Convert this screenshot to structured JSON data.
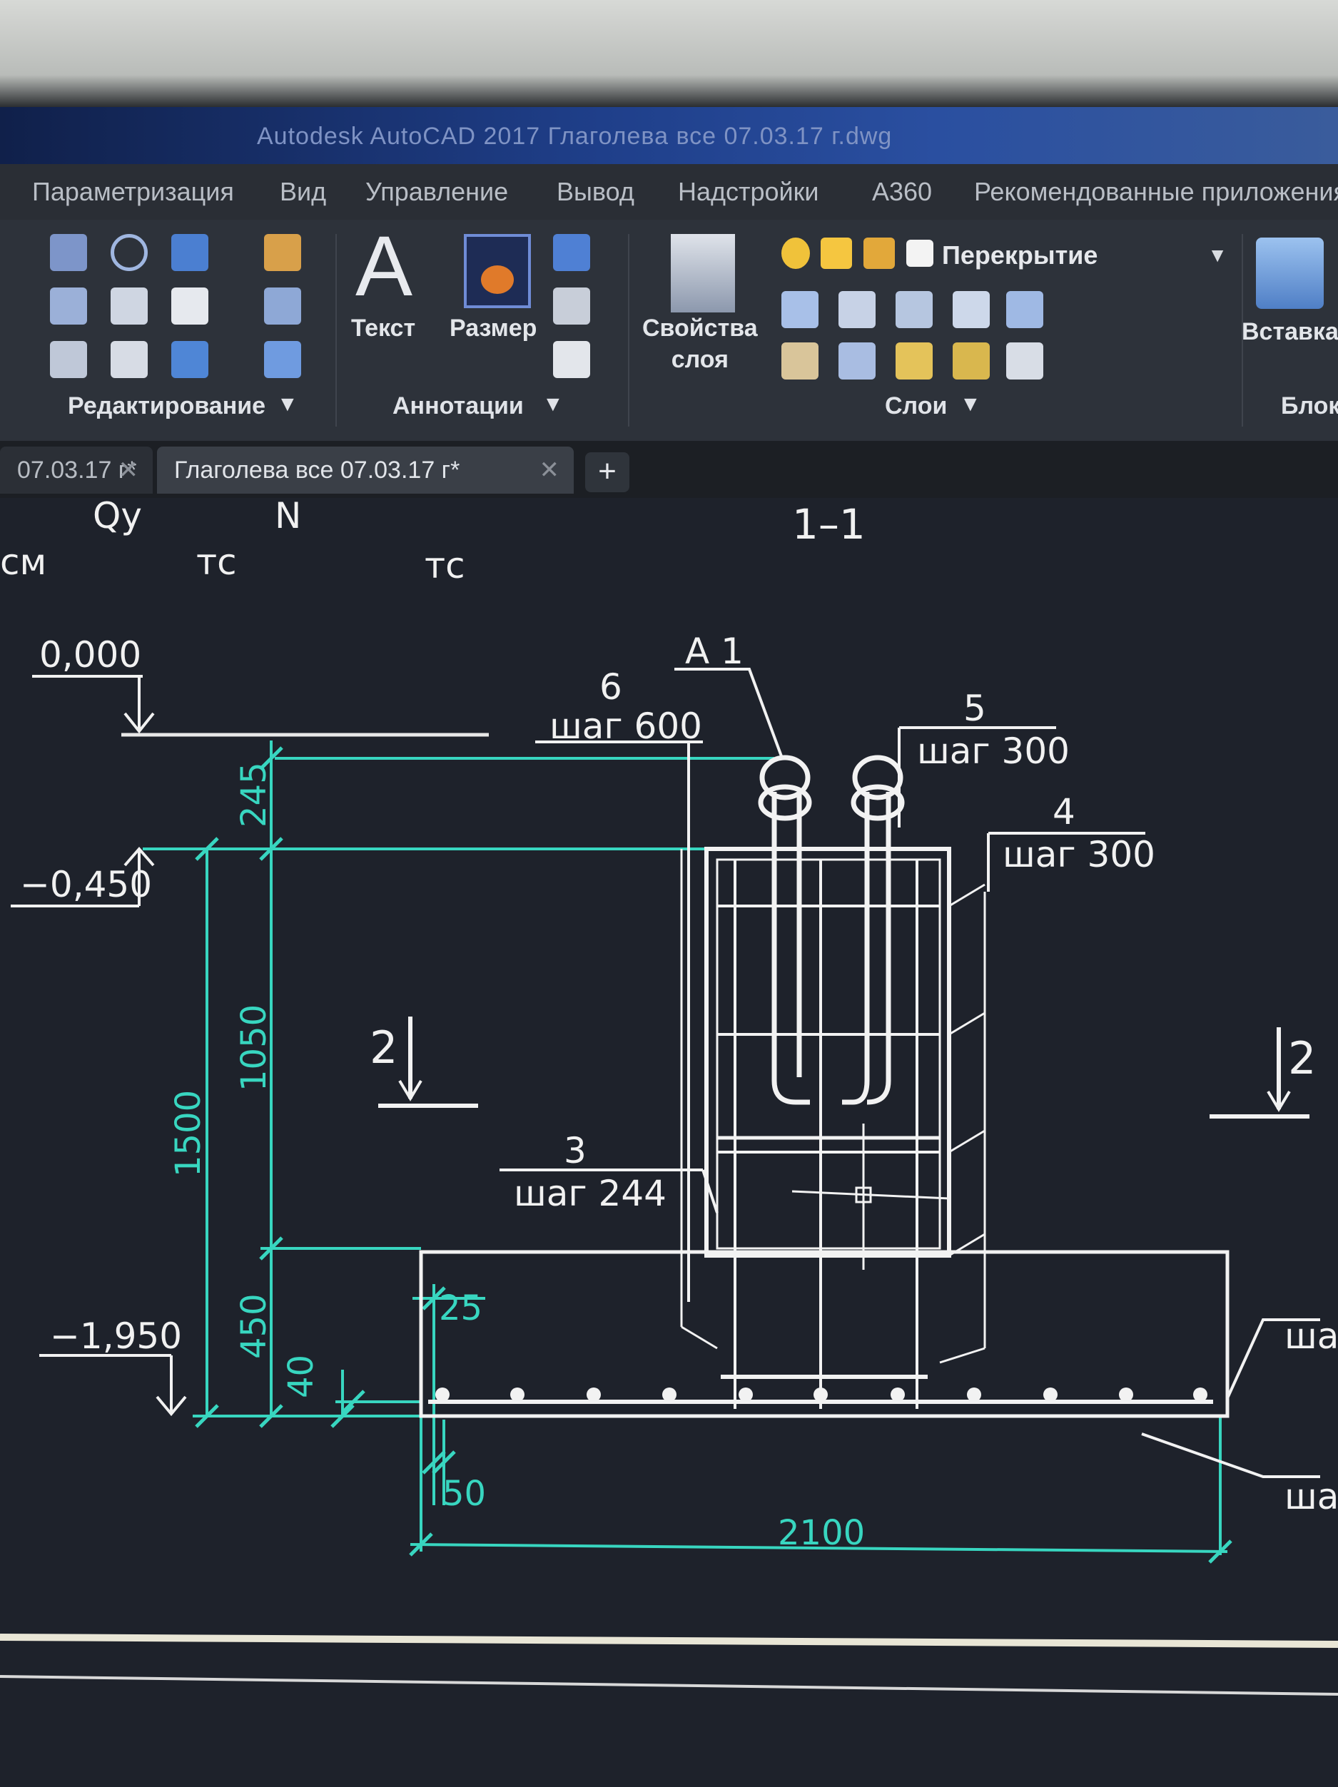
{
  "window": {
    "title": "Autodesk AutoCAD 2017   Глаголева все 07.03.17 г.dwg"
  },
  "menu": [
    "Параметризация",
    "Вид",
    "Управление",
    "Вывод",
    "Надстройки",
    "A360",
    "Рекомендованные приложения"
  ],
  "ribbon": {
    "panels": {
      "edit": "Редактирование",
      "annotations": "Аннотации",
      "layers": "Слои",
      "block": "Блок"
    },
    "buttons": {
      "text": "Текст",
      "dimension": "Размер",
      "layer_props_1": "Свойства",
      "layer_props_2": "слоя",
      "insert": "Вставка"
    },
    "layer_current": "Перекрытие"
  },
  "tabs": [
    {
      "label": "07.03.17 г*",
      "active": false
    },
    {
      "label": "Глаголева все 07.03.17 г*",
      "active": true
    }
  ],
  "drawing": {
    "header": {
      "qy": "Qy",
      "n": "N",
      "cm": "см",
      "tc1": "тс",
      "tc2": "тс"
    },
    "section_title": "1–1",
    "levels": {
      "zero": "0,000",
      "minus045": "−0,450",
      "minus195": "−1,950"
    },
    "leaders": {
      "a1": "А 1",
      "l6": "6",
      "l6_step": "шаг 600",
      "l5": "5",
      "l5_step": "шаг 300",
      "l4": "4",
      "l4_step": "шаг 300",
      "l3": "3",
      "l3_step": "шаг 244",
      "right_step1": "ша",
      "right_step2": "ша"
    },
    "dims": {
      "d245": "245",
      "d1050": "1050",
      "d1500": "1500",
      "d450": "450",
      "d40": "40",
      "d25": "25",
      "d50": "50",
      "d2100": "2100"
    },
    "section_marks": {
      "left": "2",
      "right": "2"
    }
  }
}
